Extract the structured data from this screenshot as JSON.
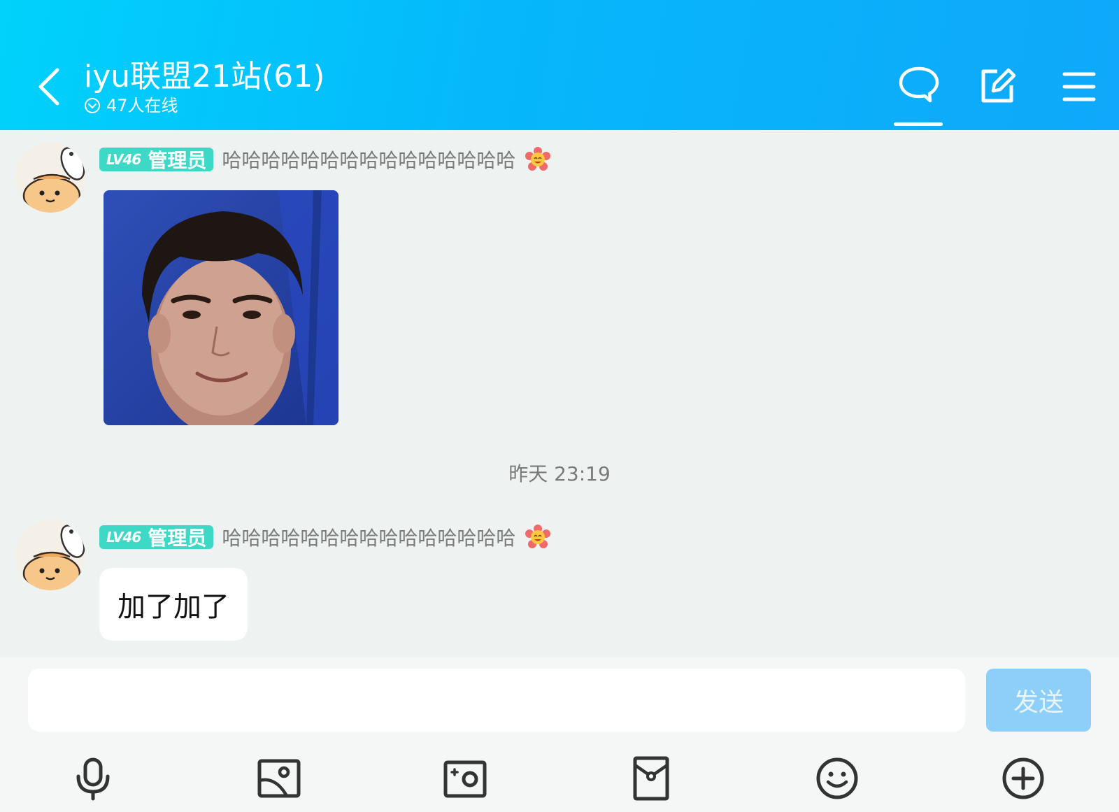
{
  "header": {
    "title": "iyu联盟21站(61)",
    "online": "47人在线"
  },
  "messages": [
    {
      "level": "LV46",
      "role": "管理员",
      "nickname": "哈哈哈哈哈哈哈哈哈哈哈哈哈哈哈",
      "type": "image",
      "image_desc": "photo"
    },
    {
      "level": "LV46",
      "role": "管理员",
      "nickname": "哈哈哈哈哈哈哈哈哈哈哈哈哈哈哈",
      "type": "text",
      "text": "加了加了"
    }
  ],
  "timestamp": "昨天 23:19",
  "composer": {
    "placeholder": "",
    "send_label": "发送"
  },
  "icons": {
    "back": "back-arrow-icon",
    "chat": "chat-bubble-icon",
    "edit": "edit-icon",
    "menu": "menu-icon",
    "voice": "microphone-icon",
    "image": "image-icon",
    "camera": "camera-icon",
    "redpacket": "red-packet-icon",
    "emoji": "emoji-icon",
    "plus": "plus-icon"
  },
  "colors": {
    "header_start": "#00d2fb",
    "header_end": "#0fa8fa",
    "badge": "#3dd9c6",
    "send_disabled": "#8dcff9"
  }
}
